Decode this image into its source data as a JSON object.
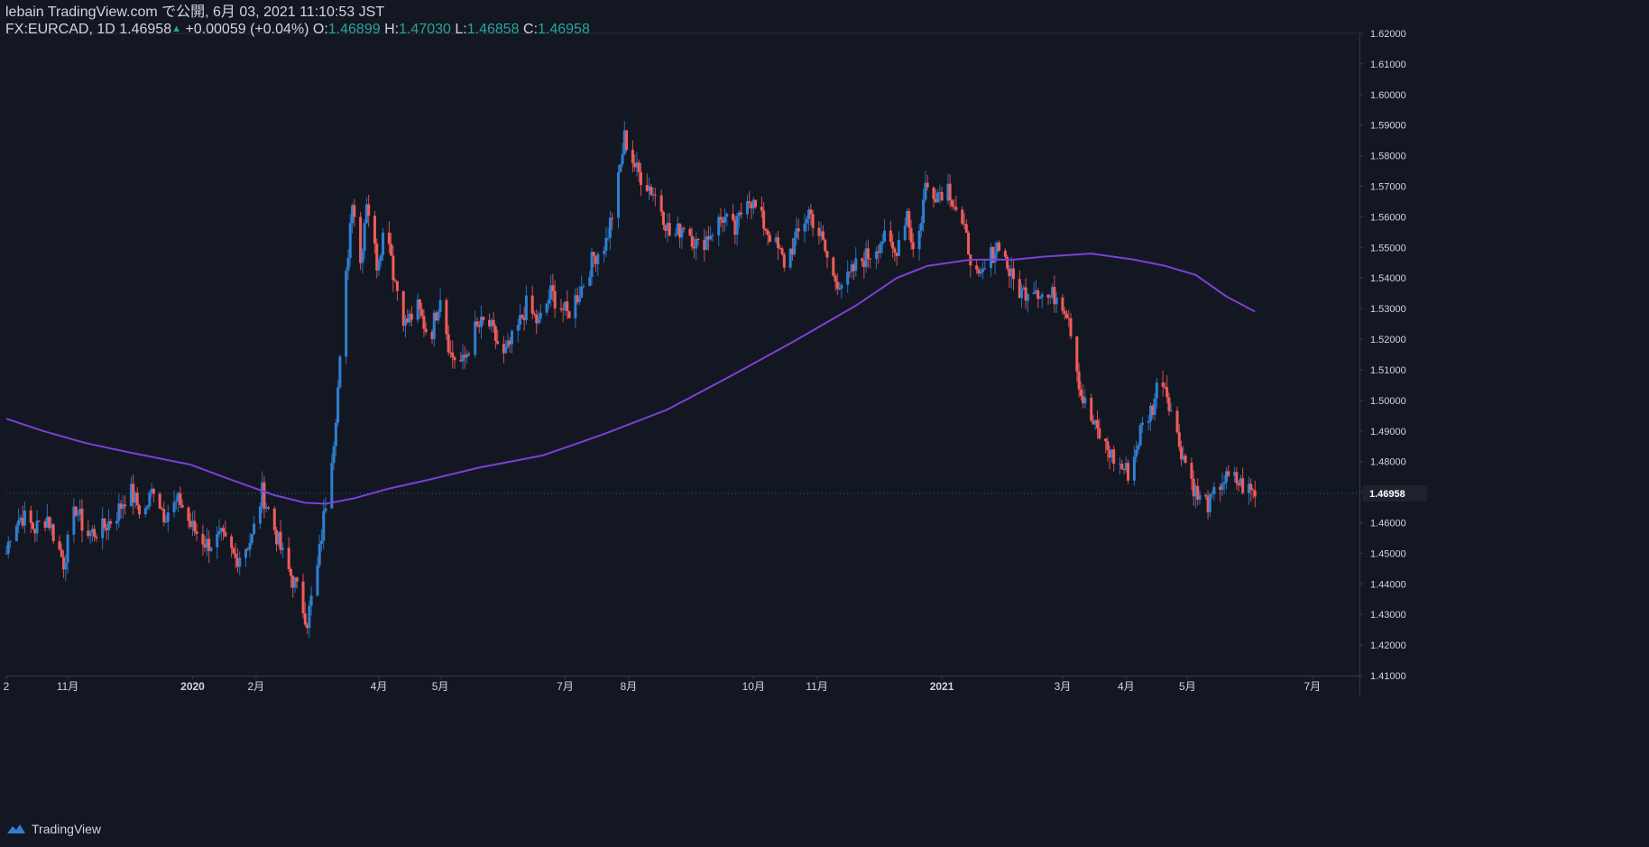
{
  "header": {
    "published_line": "lebain TradingView.com で公開, 6月 03, 2021 11:10:53 JST",
    "symbol": "FX:EURCAD, 1D",
    "last": "1.46958",
    "change_arrow": "▲",
    "change": "+0.00059 (+0.04%)",
    "o_label": "O:",
    "o_value": "1.46899",
    "h_label": "H:",
    "h_value": "1.47030",
    "l_label": "L:",
    "l_value": "1.46858",
    "c_label": "C:",
    "c_value": "1.46958"
  },
  "footer": {
    "brand": "TradingView",
    "icon": "tradingview-cloud-icon"
  },
  "colors": {
    "background": "#131722",
    "up": "#2f7fd1",
    "down": "#ef5c5a",
    "ma": "#7e3fd6",
    "axis_text": "#d1d4dc",
    "price_badge_bg": "#1e222d"
  },
  "chart_data": {
    "type": "candlestick",
    "symbol": "FX:EURCAD",
    "interval": "1D",
    "ylim": [
      1.41,
      1.62
    ],
    "x_range": [
      "2019-10-02",
      "2021-07-24"
    ],
    "y_ticks": [
      "1.41000",
      "1.42000",
      "1.43000",
      "1.44000",
      "1.45000",
      "1.46000",
      "1.47000",
      "1.48000",
      "1.49000",
      "1.50000",
      "1.51000",
      "1.52000",
      "1.53000",
      "1.54000",
      "1.55000",
      "1.56000",
      "1.57000",
      "1.58000",
      "1.59000",
      "1.60000",
      "1.61000",
      "1.62000"
    ],
    "x_ticks": [
      {
        "date": "2019-10-02",
        "label": "2"
      },
      {
        "date": "2019-11-01",
        "label": "11月"
      },
      {
        "date": "2020-01-01",
        "label": "2020"
      },
      {
        "date": "2020-02-01",
        "label": "2月"
      },
      {
        "date": "2020-04-01",
        "label": "4月"
      },
      {
        "date": "2020-05-01",
        "label": "5月"
      },
      {
        "date": "2020-07-01",
        "label": "7月"
      },
      {
        "date": "2020-08-01",
        "label": "8月"
      },
      {
        "date": "2020-10-01",
        "label": "10月"
      },
      {
        "date": "2020-11-01",
        "label": "11月"
      },
      {
        "date": "2021-01-01",
        "label": "2021"
      },
      {
        "date": "2021-03-01",
        "label": "3月"
      },
      {
        "date": "2021-04-01",
        "label": "4月"
      },
      {
        "date": "2021-05-01",
        "label": "5月"
      },
      {
        "date": "2021-07-01",
        "label": "7月"
      }
    ],
    "last_price": {
      "value": 1.46958,
      "label": "1.46958"
    },
    "close_path": [
      [
        "2019-10-02",
        1.45
      ],
      [
        "2019-10-05",
        1.46
      ],
      [
        "2019-10-10",
        1.462
      ],
      [
        "2019-10-16",
        1.458
      ],
      [
        "2019-10-22",
        1.462
      ],
      [
        "2019-10-30",
        1.447
      ],
      [
        "2019-11-05",
        1.465
      ],
      [
        "2019-11-10",
        1.456
      ],
      [
        "2019-11-18",
        1.458
      ],
      [
        "2019-11-25",
        1.463
      ],
      [
        "2019-12-01",
        1.471
      ],
      [
        "2019-12-08",
        1.462
      ],
      [
        "2019-12-13",
        1.472
      ],
      [
        "2019-12-18",
        1.463
      ],
      [
        "2019-12-26",
        1.467
      ],
      [
        "2019-12-31",
        1.459
      ],
      [
        "2020-01-08",
        1.453
      ],
      [
        "2020-01-15",
        1.455
      ],
      [
        "2020-01-22",
        1.448
      ],
      [
        "2020-01-30",
        1.455
      ],
      [
        "2020-02-04",
        1.47
      ],
      [
        "2020-02-10",
        1.458
      ],
      [
        "2020-02-15",
        1.447
      ],
      [
        "2020-02-20",
        1.44
      ],
      [
        "2020-02-26",
        1.428
      ],
      [
        "2020-03-02",
        1.445
      ],
      [
        "2020-03-06",
        1.467
      ],
      [
        "2020-03-10",
        1.488
      ],
      [
        "2020-03-13",
        1.512
      ],
      [
        "2020-03-16",
        1.54
      ],
      [
        "2020-03-19",
        1.567
      ],
      [
        "2020-03-23",
        1.545
      ],
      [
        "2020-03-26",
        1.566
      ],
      [
        "2020-03-31",
        1.545
      ],
      [
        "2020-04-05",
        1.56
      ],
      [
        "2020-04-08",
        1.542
      ],
      [
        "2020-04-14",
        1.525
      ],
      [
        "2020-04-20",
        1.53
      ],
      [
        "2020-04-26",
        1.52
      ],
      [
        "2020-05-01",
        1.535
      ],
      [
        "2020-05-06",
        1.515
      ],
      [
        "2020-05-12",
        1.512
      ],
      [
        "2020-05-18",
        1.523
      ],
      [
        "2020-05-24",
        1.526
      ],
      [
        "2020-06-01",
        1.514
      ],
      [
        "2020-06-07",
        1.522
      ],
      [
        "2020-06-12",
        1.531
      ],
      [
        "2020-06-18",
        1.525
      ],
      [
        "2020-06-24",
        1.535
      ],
      [
        "2020-07-02",
        1.528
      ],
      [
        "2020-07-09",
        1.537
      ],
      [
        "2020-07-15",
        1.547
      ],
      [
        "2020-07-21",
        1.552
      ],
      [
        "2020-07-26",
        1.567
      ],
      [
        "2020-07-30",
        1.586
      ],
      [
        "2020-08-05",
        1.575
      ],
      [
        "2020-08-11",
        1.57
      ],
      [
        "2020-08-16",
        1.565
      ],
      [
        "2020-08-22",
        1.552
      ],
      [
        "2020-08-28",
        1.558
      ],
      [
        "2020-09-04",
        1.55
      ],
      [
        "2020-09-10",
        1.555
      ],
      [
        "2020-09-16",
        1.56
      ],
      [
        "2020-09-22",
        1.555
      ],
      [
        "2020-09-28",
        1.568
      ],
      [
        "2020-10-04",
        1.56
      ],
      [
        "2020-10-10",
        1.553
      ],
      [
        "2020-10-16",
        1.545
      ],
      [
        "2020-10-22",
        1.553
      ],
      [
        "2020-10-28",
        1.562
      ],
      [
        "2020-11-03",
        1.553
      ],
      [
        "2020-11-09",
        1.54
      ],
      [
        "2020-11-15",
        1.538
      ],
      [
        "2020-11-21",
        1.545
      ],
      [
        "2020-11-27",
        1.548
      ],
      [
        "2020-12-03",
        1.553
      ],
      [
        "2020-12-09",
        1.548
      ],
      [
        "2020-12-15",
        1.562
      ],
      [
        "2020-12-19",
        1.545
      ],
      [
        "2020-12-24",
        1.57
      ],
      [
        "2020-12-30",
        1.568
      ],
      [
        "2021-01-04",
        1.57
      ],
      [
        "2021-01-09",
        1.561
      ],
      [
        "2021-01-14",
        1.55
      ],
      [
        "2021-01-19",
        1.538
      ],
      [
        "2021-01-24",
        1.546
      ],
      [
        "2021-01-29",
        1.552
      ],
      [
        "2021-02-04",
        1.54
      ],
      [
        "2021-02-09",
        1.535
      ],
      [
        "2021-02-15",
        1.538
      ],
      [
        "2021-02-21",
        1.533
      ],
      [
        "2021-02-27",
        1.535
      ],
      [
        "2021-03-04",
        1.528
      ],
      [
        "2021-03-10",
        1.502
      ],
      [
        "2021-03-16",
        1.492
      ],
      [
        "2021-03-22",
        1.485
      ],
      [
        "2021-03-28",
        1.479
      ],
      [
        "2021-04-03",
        1.476
      ],
      [
        "2021-04-08",
        1.49
      ],
      [
        "2021-04-14",
        1.498
      ],
      [
        "2021-04-18",
        1.51
      ],
      [
        "2021-04-22",
        1.5
      ],
      [
        "2021-04-26",
        1.488
      ],
      [
        "2021-05-01",
        1.478
      ],
      [
        "2021-05-06",
        1.468
      ],
      [
        "2021-05-12",
        1.466
      ],
      [
        "2021-05-18",
        1.474
      ],
      [
        "2021-05-24",
        1.474
      ],
      [
        "2021-05-30",
        1.471
      ],
      [
        "2021-06-03",
        1.4696
      ]
    ],
    "series": [
      {
        "type": "line",
        "points": [
          [
            "2019-10-02",
            1.494
          ],
          [
            "2019-10-20",
            1.49
          ],
          [
            "2019-11-10",
            1.486
          ],
          [
            "2019-12-01",
            1.483
          ],
          [
            "2019-12-31",
            1.479
          ],
          [
            "2020-01-20",
            1.474
          ],
          [
            "2020-02-10",
            1.469
          ],
          [
            "2020-02-25",
            1.4665
          ],
          [
            "2020-03-06",
            1.4662
          ],
          [
            "2020-03-20",
            1.468
          ],
          [
            "2020-04-05",
            1.471
          ],
          [
            "2020-04-25",
            1.474
          ],
          [
            "2020-05-20",
            1.478
          ],
          [
            "2020-06-20",
            1.482
          ],
          [
            "2020-07-20",
            1.489
          ],
          [
            "2020-08-20",
            1.497
          ],
          [
            "2020-09-20",
            1.508
          ],
          [
            "2020-10-20",
            1.519
          ],
          [
            "2020-11-20",
            1.531
          ],
          [
            "2020-12-10",
            1.54
          ],
          [
            "2020-12-25",
            1.544
          ],
          [
            "2021-01-15",
            1.546
          ],
          [
            "2021-02-05",
            1.546
          ],
          [
            "2021-02-20",
            1.547
          ],
          [
            "2021-03-15",
            1.548
          ],
          [
            "2021-04-05",
            1.546
          ],
          [
            "2021-04-20",
            1.544
          ],
          [
            "2021-05-05",
            1.541
          ],
          [
            "2021-05-20",
            1.534
          ],
          [
            "2021-06-03",
            1.529
          ]
        ]
      }
    ]
  }
}
